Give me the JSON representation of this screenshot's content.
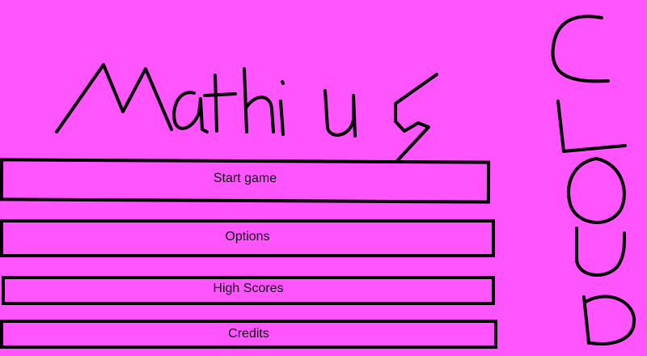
{
  "colors": {
    "background": "#FF55FF",
    "stroke": "#000000",
    "text": "#111111"
  },
  "title": {
    "text": "Mathius",
    "style": "hand-drawn"
  },
  "side_logo": {
    "text": "CLOUD",
    "style": "hand-drawn vertical letters"
  },
  "menu": {
    "items": [
      {
        "label": "Start game"
      },
      {
        "label": "Options"
      },
      {
        "label": "High Scores"
      },
      {
        "label": "Credits"
      }
    ]
  }
}
